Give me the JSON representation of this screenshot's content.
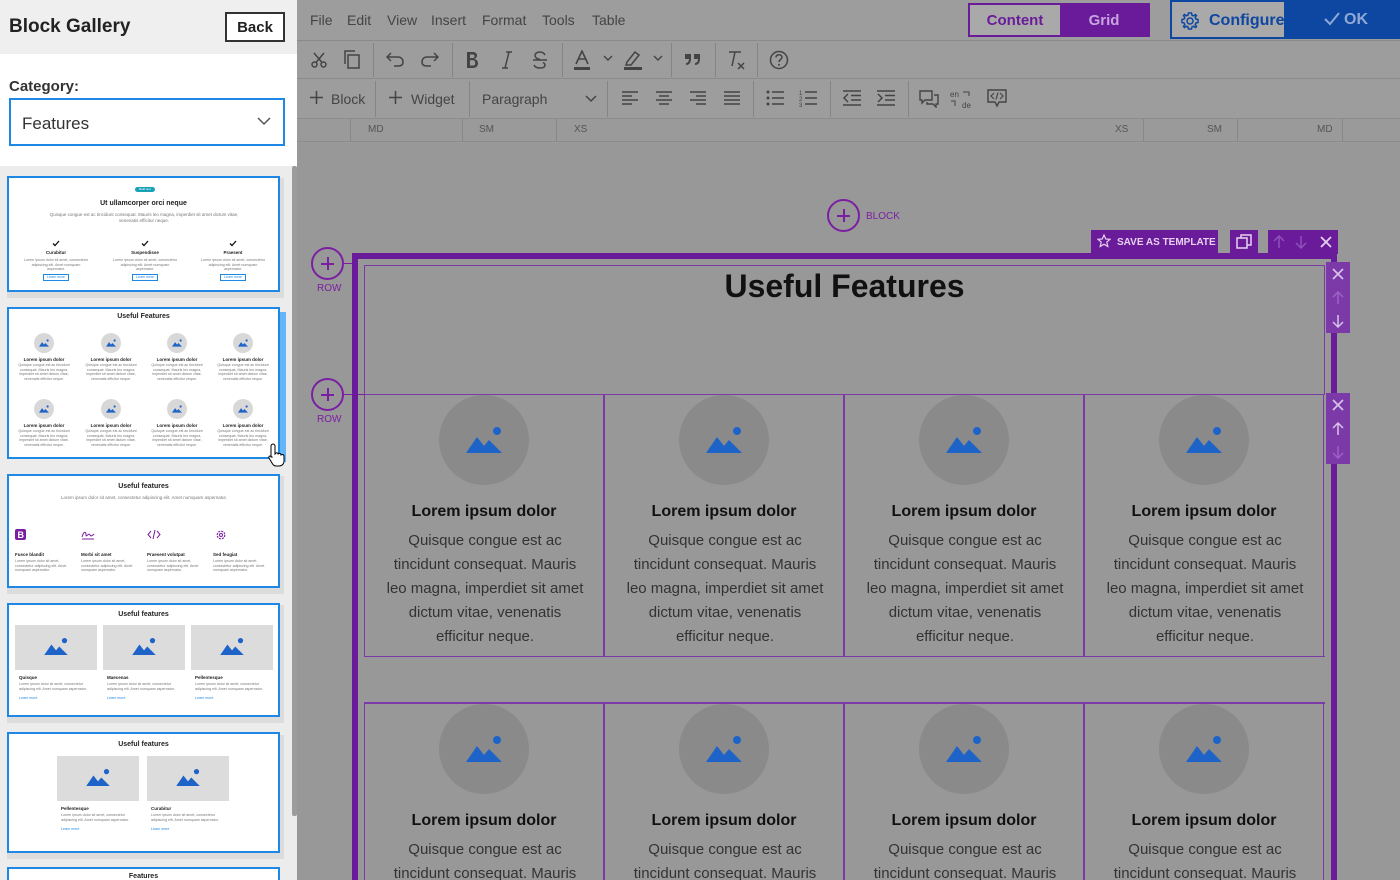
{
  "sidebar": {
    "title": "Block Gallery",
    "back_label": "Back",
    "category_label": "Category:",
    "category_value": "Features",
    "cards": [
      {
        "pill": "Bold text",
        "title": "Ut ullamcorper orci neque",
        "subtitle": "Quisque congue est ac tincidunt consequat. Mauris leo magna, imperdiet sit amet dictum vitae, venenatis efficitur neque.",
        "items": [
          {
            "heading": "Curabitur",
            "text": "Lorem ipsum dolor sit amet, consectetur adipiscing elit. Amet numquam aspernatur.",
            "button": "Learn more"
          },
          {
            "heading": "Suspendisse",
            "text": "Lorem ipsum dolor sit amet, consectetur adipiscing elit. Amet numquam aspernatur.",
            "button": "Learn more"
          },
          {
            "heading": "Praesent",
            "text": "Lorem ipsum dolor sit amet, consectetur adipiscing elit. Amet numquam aspernatur.",
            "button": "Learn more"
          }
        ]
      },
      {
        "title": "Useful Features",
        "item_heading": "Lorem ipsum dolor",
        "item_text": "Quisque congue est ac tincidunt consequat. Mauris leo magna, imperdiet sit amet dictum vitae, venenatis efficitur neque."
      },
      {
        "title": "Useful features",
        "subtitle": "Lorem ipsum dolor sit amet, consectetur adipiscing elit. Amet numquam aspernatur.",
        "items": [
          {
            "heading": "Fusce blandit",
            "text": "Lorem ipsum dolor sit amet, consectetur adipiscing elit. Amet numquam aspernatur."
          },
          {
            "heading": "Morbi sit amet",
            "text": "Lorem ipsum dolor sit amet, consectetur adipiscing elit. Amet numquam aspernatur."
          },
          {
            "heading": "Praesent volutpat",
            "text": "Lorem ipsum dolor sit amet, consectetur adipiscing elit. Amet numquam aspernatur."
          },
          {
            "heading": "Sed feugiat",
            "text": "Lorem ipsum dolor sit amet, consectetur adipiscing elit. Amet numquam aspernatur."
          }
        ]
      },
      {
        "title": "Useful features",
        "items": [
          {
            "heading": "Quisque",
            "text": "Lorem ipsum dolor sit amet, consectetur adipiscing elit. Amet numquam aspernatur.",
            "link": "Learn more"
          },
          {
            "heading": "Maecenas",
            "text": "Lorem ipsum dolor sit amet, consectetur adipiscing elit. Amet numquam aspernatur.",
            "link": "Learn more"
          },
          {
            "heading": "Pellentesque",
            "text": "Lorem ipsum dolor sit amet, consectetur adipiscing elit. Amet numquam aspernatur.",
            "link": "Learn more"
          }
        ]
      },
      {
        "title": "Useful features",
        "items": [
          {
            "heading": "Pellentesque",
            "text": "Lorem ipsum dolor sit amet, consectetur adipiscing elit. Amet numquam aspernatur.",
            "link": "Learn more"
          },
          {
            "heading": "Curabitur",
            "text": "Lorem ipsum dolor sit amet, consectetur adipiscing elit. Amet numquam aspernatur.",
            "link": "Learn more"
          }
        ]
      },
      {
        "title": "Features"
      }
    ]
  },
  "menubar": {
    "items": [
      "File",
      "Edit",
      "View",
      "Insert",
      "Format",
      "Tools",
      "Table"
    ],
    "content_label": "Content",
    "grid_label": "Grid",
    "configure_label": "Configure",
    "ok_label": "OK"
  },
  "toolbar": {
    "block_label": "Block",
    "widget_label": "Widget",
    "format_value": "Paragraph",
    "lang_icon_text": "en de"
  },
  "ruler": {
    "labels_left": [
      "MD",
      "SM",
      "XS"
    ],
    "labels_right": [
      "XS",
      "SM",
      "MD"
    ]
  },
  "canvas": {
    "block_add_label": "BLOCK",
    "row_add_label": "ROW",
    "save_template_label": "SAVE AS TEMPLATE",
    "block_title": "Useful Features",
    "features": [
      {
        "heading": "Lorem ipsum dolor",
        "text": "Quisque congue est ac tincidunt consequat. Mauris leo magna, imperdiet sit amet dictum vitae, venenatis efficitur neque."
      },
      {
        "heading": "Lorem ipsum dolor",
        "text": "Quisque congue est ac tincidunt consequat. Mauris leo magna, imperdiet sit amet dictum vitae, venenatis efficitur neque."
      },
      {
        "heading": "Lorem ipsum dolor",
        "text": "Quisque congue est ac tincidunt consequat. Mauris leo magna, imperdiet sit amet dictum vitae, venenatis efficitur neque."
      },
      {
        "heading": "Lorem ipsum dolor",
        "text": "Quisque congue est ac tincidunt consequat. Mauris leo magna, imperdiet sit amet dictum vitae, venenatis efficitur neque."
      },
      {
        "heading": "Lorem ipsum dolor",
        "text": "Quisque congue est ac tincidunt consequat. Mauris"
      },
      {
        "heading": "Lorem ipsum dolor",
        "text": "Quisque congue est ac tincidunt consequat. Mauris"
      },
      {
        "heading": "Lorem ipsum dolor",
        "text": "Quisque congue est ac tincidunt consequat. Mauris"
      },
      {
        "heading": "Lorem ipsum dolor",
        "text": "Quisque congue est ac tincidunt consequat. Mauris"
      }
    ]
  },
  "colors": {
    "accent_purple": "#6a1b9a",
    "ok_blue": "#0d47a1",
    "select_blue": "#1e88e5",
    "image_icon_blue": "#1e63c8"
  }
}
